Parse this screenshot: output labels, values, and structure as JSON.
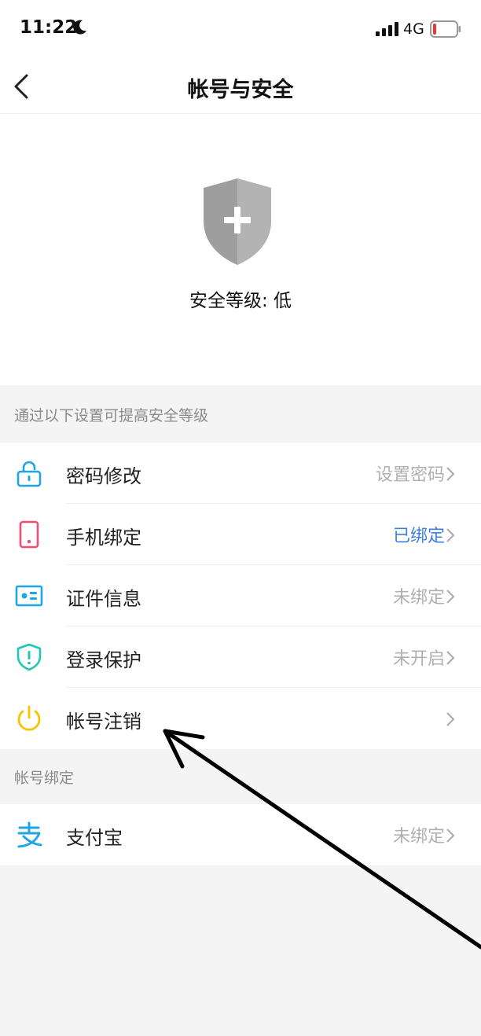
{
  "status_bar": {
    "time": "11:22",
    "network": "4G"
  },
  "nav": {
    "title": "帐号与安全"
  },
  "security": {
    "level_text": "安全等级: 低"
  },
  "sections": {
    "improve_hint": "通过以下设置可提高安全等级",
    "account_binding": "帐号绑定"
  },
  "items": [
    {
      "label": "密码修改",
      "value": "设置密码",
      "icon": "lock-icon"
    },
    {
      "label": "手机绑定",
      "value": "已绑定",
      "icon": "phone-icon"
    },
    {
      "label": "证件信息",
      "value": "未绑定",
      "icon": "id-card-icon"
    },
    {
      "label": "登录保护",
      "value": "未开启",
      "icon": "shield-alert-icon"
    },
    {
      "label": "帐号注销",
      "value": "",
      "icon": "power-icon"
    }
  ],
  "bindings": [
    {
      "label": "支付宝",
      "value": "未绑定",
      "icon": "alipay-icon"
    }
  ],
  "colors": {
    "bound_value": "#3b7fe0",
    "muted_value": "#b0b0b0",
    "lock_icon": "#1ea5e6",
    "phone_icon": "#f0506e",
    "id_icon": "#1ea5e6",
    "shield_icon": "#1ec8b4",
    "power_icon": "#f6c400",
    "alipay_icon": "#1ea5e6"
  }
}
